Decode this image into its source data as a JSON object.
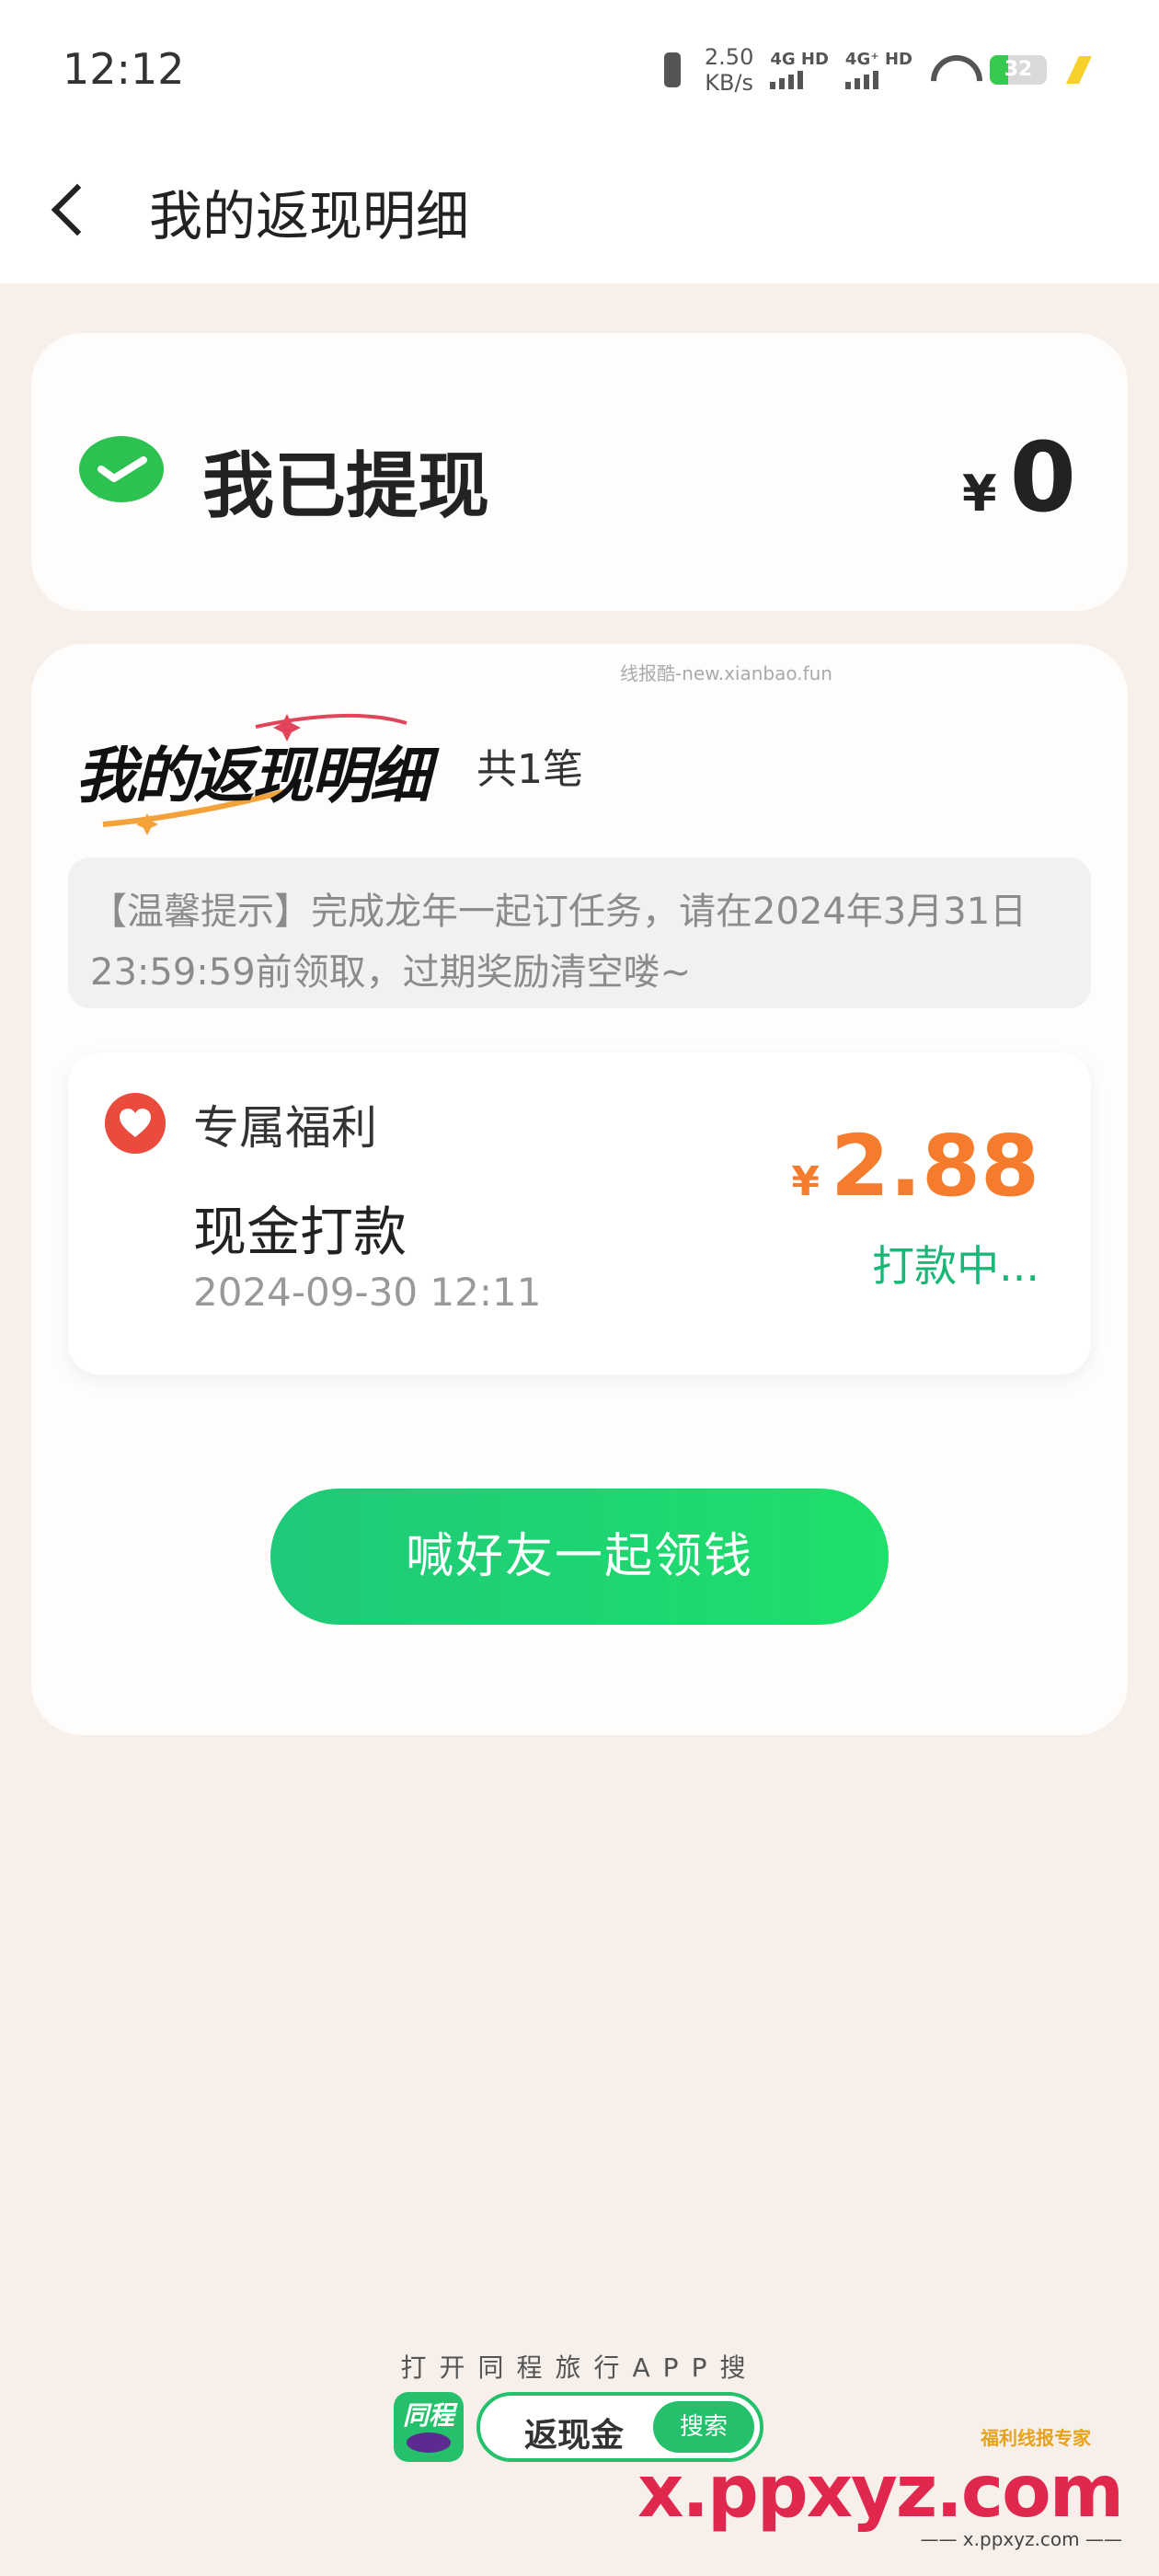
{
  "status_bar": {
    "time": "12:12",
    "speed_value": "2.50",
    "speed_unit": "KB/s",
    "net1": "4G HD",
    "net2": "4G⁺ HD",
    "battery": "32",
    "battery_level": 0.32
  },
  "header": {
    "title": "我的返现明细"
  },
  "withdrawn": {
    "label": "我已提现",
    "currency": "¥",
    "amount": "0"
  },
  "detail": {
    "watermark": "线报酷-new.xianbao.fun",
    "title": "我的返现明细",
    "count": "共1笔",
    "notice": "【温馨提示】完成龙年一起订任务，请在2024年3月31日23:59:59前领取，过期奖励清空喽~",
    "items": [
      {
        "tag": "专属福利",
        "name": "现金打款",
        "time": "2024-09-30 12:11",
        "currency": "¥",
        "amount": "2.88",
        "status": "打款中..."
      }
    ],
    "invite_button": "喊好友一起领钱"
  },
  "footer": {
    "hint": "打开同程旅行APP搜",
    "app_name": "同程",
    "keyword": "返现金",
    "search_label": "搜索"
  },
  "site_watermark": {
    "badge": "福利线报专家",
    "domain": "x.ppxyz.com",
    "sub": "—— x.ppxyz.com ——"
  },
  "colors": {
    "accent_green": "#24c06b",
    "amount_orange": "#f47c2c",
    "status_green": "#19b776",
    "page_bg": "#f7efea"
  }
}
